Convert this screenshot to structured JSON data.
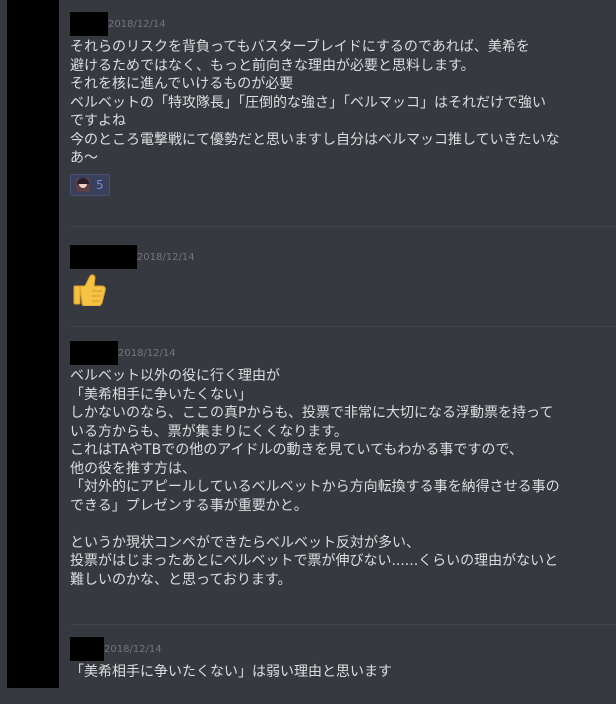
{
  "messages": [
    {
      "timestamp": "2018/12/14",
      "lines": "それらのリスクを背負ってもバスターブレイドにするのであれば、美希を\n避けるためではなく、もっと前向きな理由が必要と思料します。\nそれを核に進んでいけるものが必要\nベルベットの「特攻隊長」「圧倒的な強さ」「ベルマッコ」はそれだけで強い\nですよね\n今のところ電撃戦にて優勢だと思いますし自分はベルマッコ推していきたいな\nあ〜",
      "reaction": {
        "icon": "character-avatar-emoji",
        "count": "5"
      }
    },
    {
      "timestamp": "2018/12/14",
      "emoji": "thumbs-up-icon"
    },
    {
      "timestamp": "2018/12/14",
      "lines": "ベルベット以外の役に行く理由が\n「美希相手に争いたくない」\nしかないのなら、ここの真Pからも、投票で非常に大切になる浮動票を持って\nいる方からも、票が集まりにくくなります。\nこれはTAやTBでの他のアイドルの動きを見ていてもわかる事ですので、\n他の役を推す方は、\n「対外的にアピールしているベルベットから方向転換する事を納得させる事の\nできる」プレゼンする事が重要かと。\n\nというか現状コンペができたらベルベット反対が多い、\n投票がはじまったあとにベルベットで票が伸びない......くらいの理由がないと\n難しいのかな、と思っております。"
    },
    {
      "timestamp": "2018/12/14",
      "lines": "「美希相手に争いたくない」は弱い理由と思います"
    }
  ],
  "colors": {
    "background": "#36393f",
    "text": "#dcddde",
    "timestamp": "#72767d",
    "reaction_count": "#7289da",
    "thumbs": "#f5c242"
  }
}
